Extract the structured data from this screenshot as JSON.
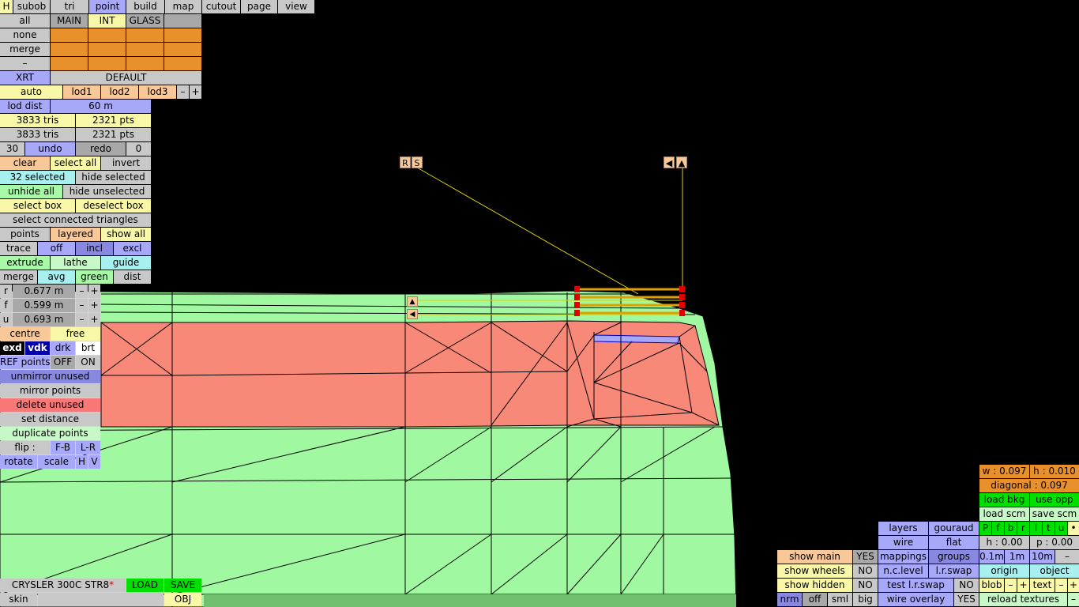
{
  "menu": [
    "H",
    "subob",
    "tri",
    "point",
    "build",
    "map",
    "cutout",
    "page",
    "view"
  ],
  "sel_row": [
    "all",
    "MAIN",
    "INT",
    "GLASS"
  ],
  "none_label": "none",
  "merge_label": "merge",
  "dash_label": "–",
  "xrt": "XRT",
  "default_label": "DEFAULT",
  "lod": [
    "auto",
    "lod1",
    "lod2",
    "lod3",
    "–",
    "+"
  ],
  "lod_dist_label": "lod dist",
  "lod_dist_value": "60 m",
  "tris1": "3833 tris",
  "pts1": "2321 pts",
  "tris2": "3833 tris",
  "pts2": "2321 pts",
  "undo_row": [
    "30",
    "undo",
    "redo",
    "0"
  ],
  "clear_row": [
    "clear",
    "select all",
    "invert"
  ],
  "selected_row": [
    "32 selected",
    "hide selected"
  ],
  "unhide_row": [
    "unhide all",
    "hide unselected"
  ],
  "box_row": [
    "select box",
    "deselect box"
  ],
  "connected": "select connected triangles",
  "points_row": [
    "points",
    "layered",
    "show all"
  ],
  "trace_row": [
    "trace",
    "off",
    "incl",
    "excl"
  ],
  "extrude_row": [
    "extrude",
    "lathe",
    "guide"
  ],
  "merge_row": [
    "merge",
    "avg",
    "green",
    "dist"
  ],
  "r": {
    "label": "r",
    "value": "0.677 m"
  },
  "f": {
    "label": "f",
    "value": "0.599 m"
  },
  "u": {
    "label": "u",
    "value": "0.693 m"
  },
  "centre_row": [
    "centre",
    "free"
  ],
  "exd_row": [
    "exd",
    "vdk",
    "drk",
    "brt"
  ],
  "ref_row": [
    "REF points",
    "OFF",
    "ON"
  ],
  "unmirror": "unmirror unused",
  "mirror": "mirror points",
  "delete_unused": "delete unused",
  "set_distance": "set distance",
  "duplicate": "duplicate points",
  "flip_row": [
    "flip :",
    "F-B",
    "L-R"
  ],
  "rotate_row": [
    "rotate",
    "scale",
    "H",
    "V"
  ],
  "model_name": "CRYSLER 300C STR8",
  "load": "LOAD",
  "save": "SAVE",
  "skin": "skin",
  "obj": "OBJ",
  "handles": {
    "r": "R",
    "s": "S",
    "left": "◀",
    "up": "▲",
    "small_up": "▲",
    "small_left": "◀"
  },
  "right": {
    "w": "w : 0.097",
    "h": "h : 0.010",
    "diagonal": "diagonal : 0.097",
    "load_bkg": "load bkg",
    "use_opp": "use opp",
    "load_scm": "load scm",
    "save_scm": "save scm",
    "letters": [
      "P",
      "f",
      "b",
      "r",
      "l",
      "t",
      "u",
      "•"
    ],
    "h2": "h : 0.00",
    "p2": "p : 0.00",
    "steps": [
      "0.1m",
      "1m",
      "10m",
      "–"
    ],
    "origin": "origin",
    "object": "object",
    "blob": "blob",
    "text": "text",
    "pm": [
      "–",
      "+"
    ],
    "reload": "reload textures",
    "reload_minus": "–"
  },
  "mid": {
    "layers": "layers",
    "gouraud": "gouraud",
    "wire": "wire",
    "flat": "flat",
    "mappings": "mappings",
    "groups": "groups",
    "nclevel": "n.c.level",
    "lrswap": "l.r.swap",
    "test_lr": "test l.r.swap",
    "test_no": "NO",
    "wire_overlay": "wire overlay",
    "wire_yes": "YES"
  },
  "show": {
    "main": "show main",
    "main_v": "YES",
    "wheels": "show wheels",
    "wheels_v": "NO",
    "hidden": "show hidden",
    "hidden_v": "NO",
    "nrm": "nrm",
    "off": "off",
    "sml": "sml",
    "big": "big"
  },
  "colors": {
    "mesh_green": "#a0f8a0",
    "mesh_red": "#f88878",
    "accent_orange": "#e8902c"
  }
}
